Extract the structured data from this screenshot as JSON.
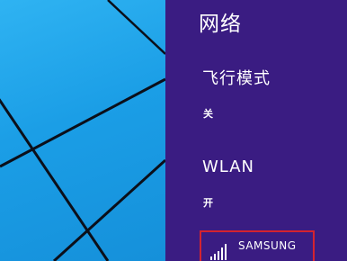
{
  "colors": {
    "panel_background": "#3a1c82",
    "desktop_background": "#1b9ee6",
    "highlight_border": "#d4232f"
  },
  "network_panel": {
    "title": "网络",
    "airplane_mode": {
      "label": "飞行模式",
      "state": "关"
    },
    "wlan": {
      "label": "WLAN",
      "state": "开"
    },
    "networks": [
      {
        "name": "SAMSUNG",
        "icon": "wifi-signal-icon"
      }
    ]
  }
}
